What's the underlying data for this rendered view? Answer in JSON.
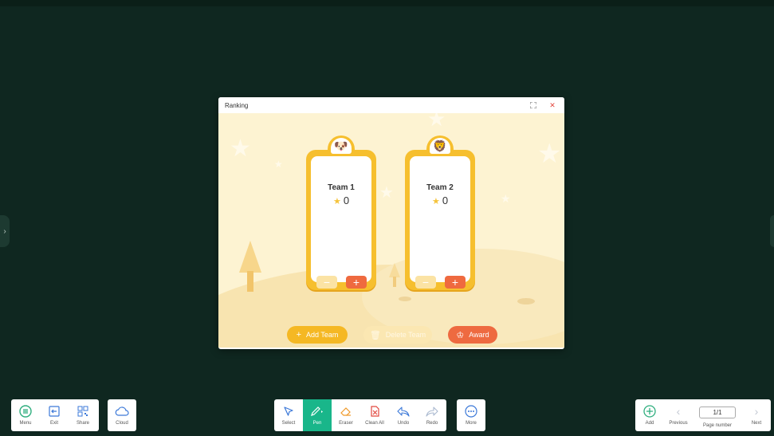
{
  "dialog": {
    "title": "Ranking",
    "teams": [
      {
        "name": "Team 1",
        "score": "0",
        "avatar": "🐶"
      },
      {
        "name": "Team 2",
        "score": "0",
        "avatar": "🦁"
      }
    ],
    "add_team_label": "Add Team",
    "delete_team_label": "Delete Team",
    "award_label": "Award"
  },
  "toolbar_left": [
    {
      "label": "Menu",
      "icon": "menu-icon"
    },
    {
      "label": "Exit",
      "icon": "exit-icon"
    },
    {
      "label": "Share",
      "icon": "qr-share-icon"
    }
  ],
  "cloud": {
    "label": "Cloud",
    "icon": "cloud-icon"
  },
  "toolbar_center": [
    {
      "label": "Select",
      "icon": "cursor-icon"
    },
    {
      "label": "Pen",
      "icon": "pen-icon"
    },
    {
      "label": "Eraser",
      "icon": "eraser-icon"
    },
    {
      "label": "Clean All",
      "icon": "clean-all-icon"
    },
    {
      "label": "Undo",
      "icon": "undo-icon"
    },
    {
      "label": "Redo",
      "icon": "redo-icon"
    }
  ],
  "more": {
    "label": "More",
    "icon": "more-icon"
  },
  "toolbar_right": {
    "add_label": "Add",
    "previous_label": "Previous",
    "page_value": "1/1",
    "page_number_label": "Page number",
    "next_label": "Next"
  },
  "colors": {
    "board": "#0f2720",
    "accent": "#19b68a",
    "card": "#f6bf2e",
    "plus": "#ef6a3f"
  }
}
